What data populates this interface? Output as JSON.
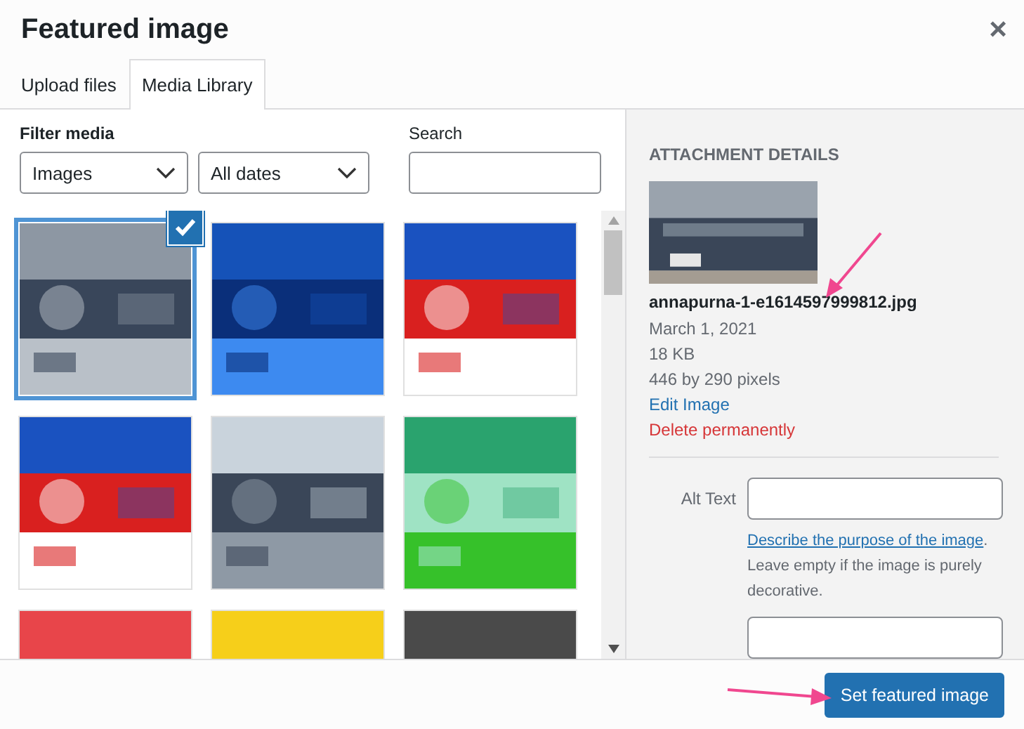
{
  "title": "Featured image",
  "close": "×",
  "tabs": [
    {
      "label": "Upload files",
      "selected": false
    },
    {
      "label": "Media Library",
      "selected": true
    }
  ],
  "filters": {
    "label": "Filter media",
    "type": "Images",
    "date": "All dates"
  },
  "search": {
    "label": "Search"
  },
  "media": [
    {
      "kind": "picture",
      "selected": true
    },
    {
      "kind": "picture",
      "selected": false
    },
    {
      "kind": "picture",
      "selected": false
    },
    {
      "kind": "picture",
      "selected": false
    },
    {
      "kind": "picture",
      "selected": false
    },
    {
      "kind": "picture",
      "selected": false
    },
    {
      "kind": "picture",
      "selected": false
    },
    {
      "kind": "picture",
      "selected": false
    },
    {
      "kind": "picture",
      "selected": false
    }
  ],
  "details": {
    "heading": "ATTACHMENT DETAILS",
    "filename": "annapurna-1-e1614597999812.jpg",
    "date": "March 1, 2021",
    "size": "18 KB",
    "dimensions": "446 by 290 pixels",
    "edit": "Edit Image",
    "delete": "Delete permanently",
    "alt_label": "Alt Text",
    "alt_help_link": "Describe the purpose of the image",
    "alt_help": ". Leave empty if the image is purely decorative."
  },
  "primary_button": "Set featured image"
}
